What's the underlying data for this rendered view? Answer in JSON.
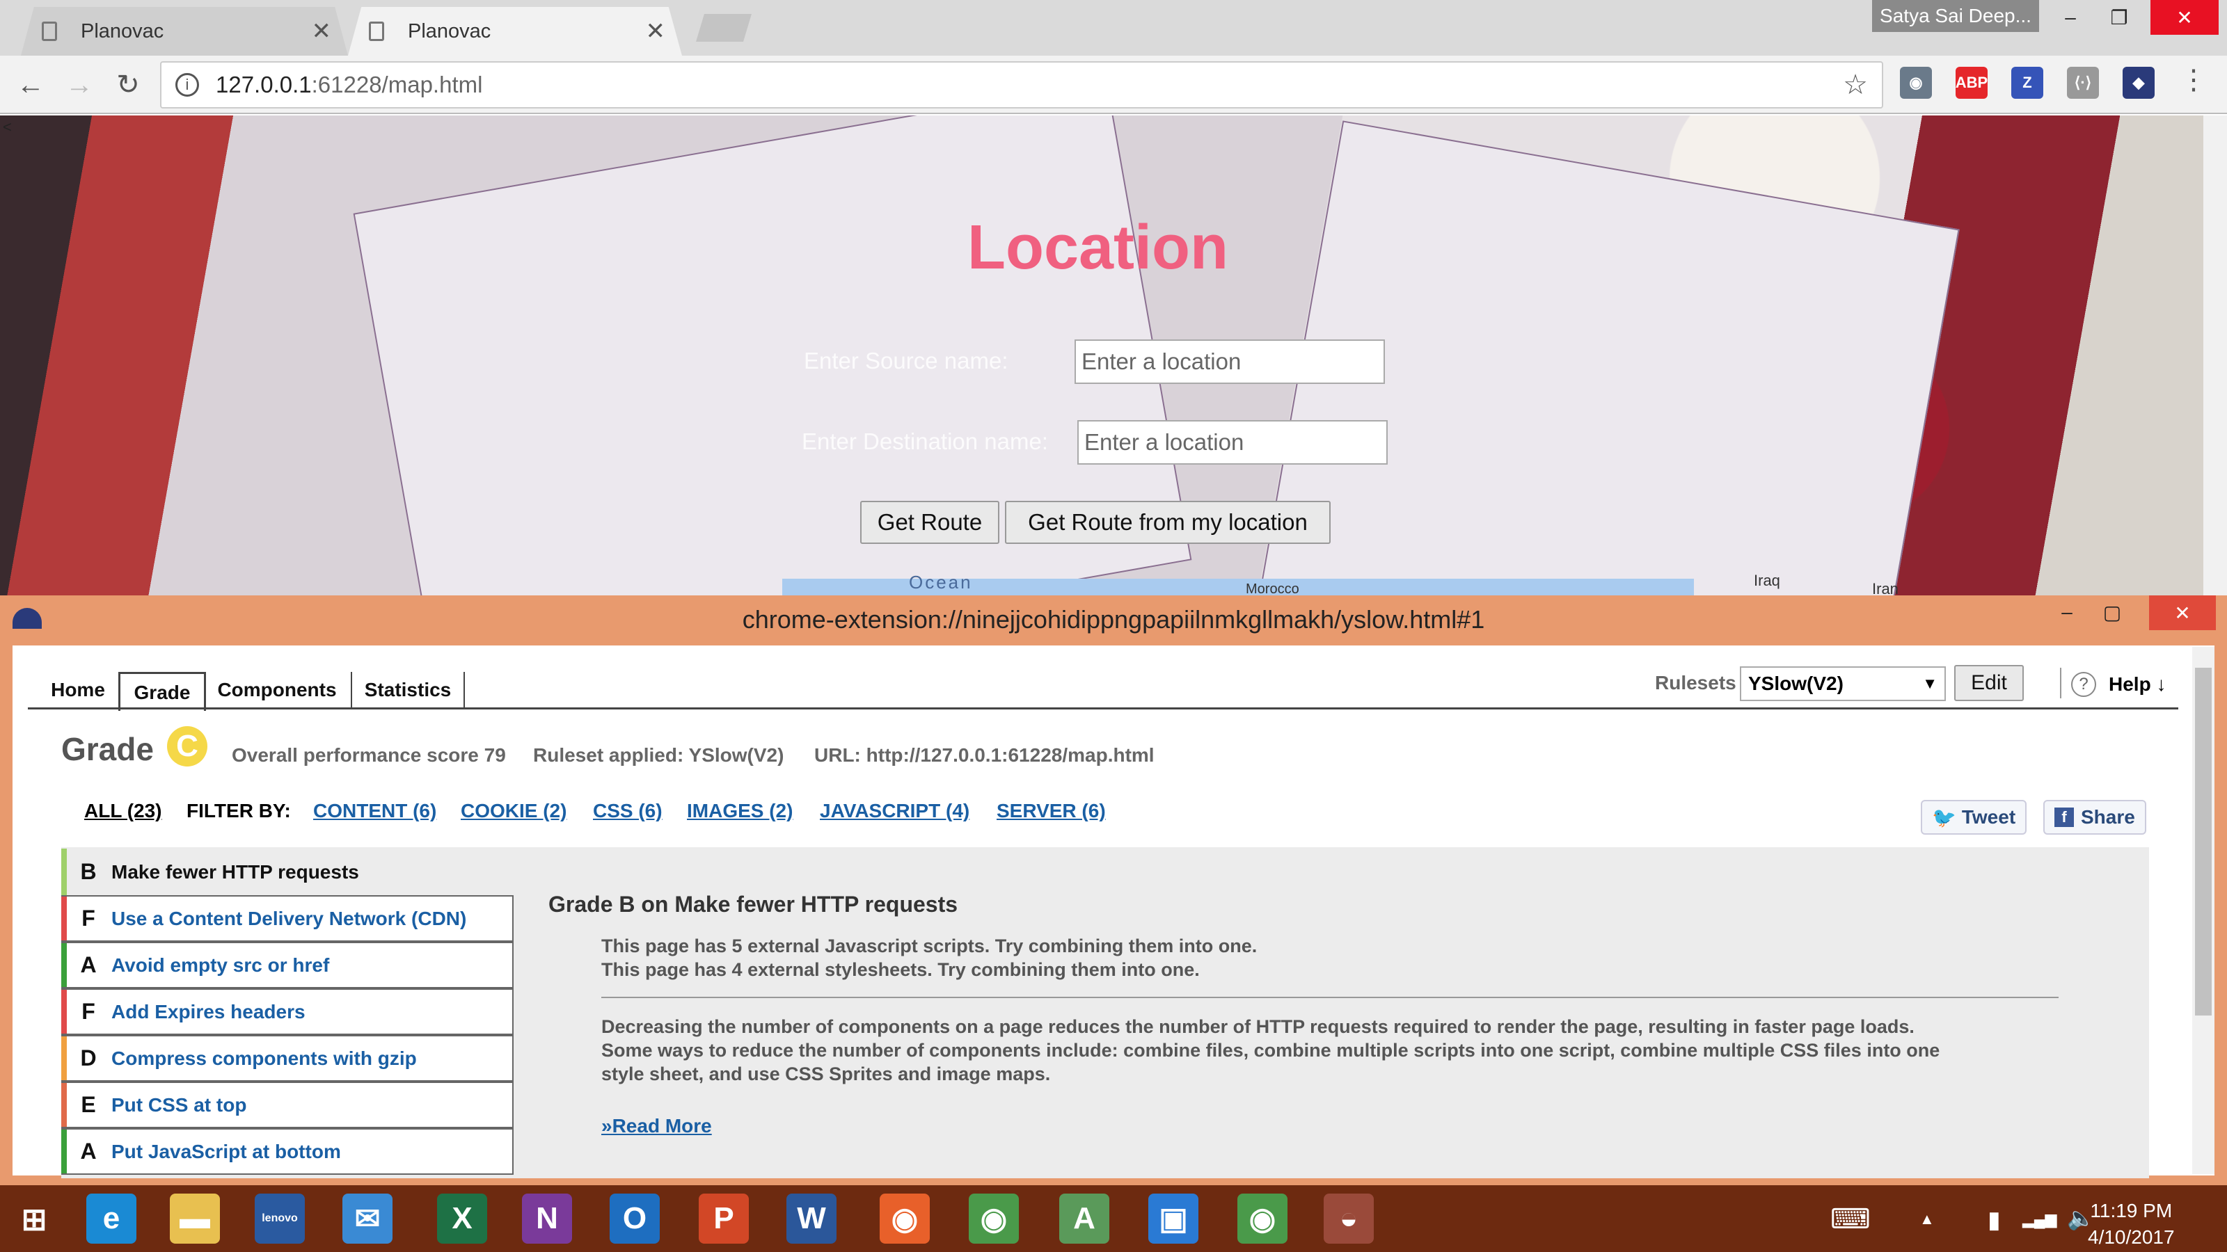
{
  "browser": {
    "tabs": [
      {
        "label": "Planovac",
        "close": "✕"
      },
      {
        "label": "Planovac",
        "close": "✕"
      }
    ],
    "profile": "Satya Sai Deep...",
    "window_controls": {
      "minimize": "–",
      "restore": "❐",
      "close": "✕"
    },
    "nav": {
      "back": "←",
      "forward": "→",
      "reload": "↻"
    },
    "url_host": "127.0.0.1",
    "url_rest": ":61228/map.html",
    "info_glyph": "i",
    "star": "☆",
    "extensions": [
      {
        "name": "eye-extension-icon",
        "label": "◉",
        "color": "#6a7a8a"
      },
      {
        "name": "adblock-icon",
        "label": "ABP",
        "color": "#e5262a"
      },
      {
        "name": "zotero-icon",
        "label": "Z",
        "color": "#3554b8"
      },
      {
        "name": "code-extension-icon",
        "label": "⟨·⟩",
        "color": "#999999"
      },
      {
        "name": "yslow-extension-icon",
        "label": "◆",
        "color": "#2a3a7a"
      }
    ],
    "menu": "⋮"
  },
  "page": {
    "title": "Location",
    "source_label": "Enter Source name:",
    "source_placeholder": "Enter a location",
    "dest_label": "Enter Destination name:",
    "dest_placeholder": "Enter a location",
    "get_route": "Get Route",
    "get_route_my_location": "Get Route from my location",
    "map_labels": [
      "Ocean",
      "Morocco",
      "Iraq",
      "Iran"
    ],
    "corner_mark": "<"
  },
  "yslow": {
    "window_title": "chrome-extension://ninejjcohidippngpapiilnmkgllmakh/yslow.html#1",
    "window_controls": {
      "minimize": "–",
      "restore": "▢",
      "close": "✕"
    },
    "tabs": [
      "Home",
      "Grade",
      "Components",
      "Statistics"
    ],
    "active_tab": "Grade",
    "rulesets_label": "Rulesets",
    "ruleset_value": "YSlow(V2)",
    "edit": "Edit",
    "help": "Help ↓",
    "help_icon": "?",
    "grade_label": "Grade",
    "grade": "C",
    "overall": "Overall performance score 79",
    "ruleset_applied": "Ruleset applied: YSlow(V2)",
    "url": "URL: http://127.0.0.1:61228/map.html",
    "all": "ALL (23)",
    "filter_by": "FILTER BY:",
    "filters": [
      "CONTENT (6)",
      "COOKIE (2)",
      "CSS (6)",
      "IMAGES (2)",
      "JAVASCRIPT (4)",
      "SERVER (6)"
    ],
    "tweet": "Tweet",
    "share": "Share",
    "rules": [
      {
        "grade": "B",
        "title": "Make fewer HTTP requests",
        "color": "#9fd06a"
      },
      {
        "grade": "F",
        "title": "Use a Content Delivery Network (CDN)",
        "color": "#e04a4a"
      },
      {
        "grade": "A",
        "title": "Avoid empty src or href",
        "color": "#3aa03a"
      },
      {
        "grade": "F",
        "title": "Add Expires headers",
        "color": "#e04a4a"
      },
      {
        "grade": "D",
        "title": "Compress components with gzip",
        "color": "#f0a040"
      },
      {
        "grade": "E",
        "title": "Put CSS at top",
        "color": "#e06a4a"
      },
      {
        "grade": "A",
        "title": "Put JavaScript at bottom",
        "color": "#3aa03a"
      }
    ],
    "detail_title": "Grade B on Make fewer HTTP requests",
    "detail_line1": "This page has 5 external Javascript scripts. Try combining them into one.",
    "detail_line2": "This page has 4 external stylesheets. Try combining them into one.",
    "detail_para1": "Decreasing the number of components on a page reduces the number of HTTP requests required to render the page, resulting in faster page loads.",
    "detail_para2": "Some ways to reduce the number of components include: combine files, combine multiple scripts into one script, combine multiple CSS files into one",
    "detail_para3": "style sheet, and use CSS Sprites and image maps.",
    "read_more": "»Read More"
  },
  "taskbar": {
    "apps": [
      {
        "name": "windows-start-icon",
        "label": "⊞",
        "bg": "transparent"
      },
      {
        "name": "ie-icon",
        "label": "e",
        "bg": "#1a8ad4"
      },
      {
        "name": "file-explorer-icon",
        "label": "▬",
        "bg": "#e8c050"
      },
      {
        "name": "lenovo-icon",
        "label": "lenovo",
        "bg": "#2a5aa0"
      },
      {
        "name": "mail-icon",
        "label": "✉",
        "bg": "#3a8ad4"
      },
      {
        "name": "excel-icon",
        "label": "X",
        "bg": "#1e7145"
      },
      {
        "name": "onenote-icon",
        "label": "N",
        "bg": "#7a3a9a"
      },
      {
        "name": "outlook-icon",
        "label": "O",
        "bg": "#1e6ec0"
      },
      {
        "name": "powerpoint-icon",
        "label": "P",
        "bg": "#d24726"
      },
      {
        "name": "word-icon",
        "label": "W",
        "bg": "#2b579a"
      },
      {
        "name": "firefox-icon",
        "label": "◉",
        "bg": "#e8602a"
      },
      {
        "name": "chrome-icon",
        "label": "◉",
        "bg": "#4a9a4a"
      },
      {
        "name": "android-studio-icon",
        "label": "A",
        "bg": "#5a9a5a"
      },
      {
        "name": "app-icon",
        "label": "▣",
        "bg": "#2a7ad4"
      },
      {
        "name": "chrome-icon-2",
        "label": "◉",
        "bg": "#4a9a4a"
      },
      {
        "name": "yslow-taskbar-icon",
        "label": "◒",
        "bg": "#9a4a3a"
      }
    ],
    "time": "11:19 PM",
    "date": "4/10/2017",
    "tray": [
      "⌨",
      "▲",
      "▮",
      "▂▄▆",
      "🔈"
    ]
  }
}
